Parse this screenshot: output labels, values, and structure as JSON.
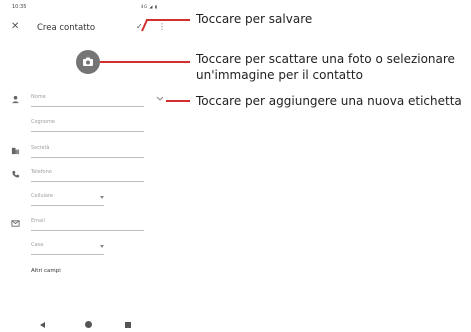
{
  "status": {
    "time": "10:35",
    "icons": "4G ◢ ▮"
  },
  "topbar": {
    "close_glyph": "✕",
    "title": "Crea contatto",
    "check_glyph": "✓",
    "more_glyph": "⋮"
  },
  "form": {
    "name_placeholder": "Nome",
    "surname_placeholder": "Cognome",
    "company_placeholder": "Società",
    "phone_placeholder": "Telefono",
    "phone_type": "Cellulare",
    "email_placeholder": "Email",
    "email_type": "Casa",
    "more_fields": "Altri campi"
  },
  "callouts": {
    "save": "Toccare per salvare",
    "photo": "Toccare per scattare una foto o selezionare un'immagine per il contatto",
    "label": "Toccare per aggiungere una nuova etichetta"
  },
  "colors": {
    "callout_line": "#d32f2f",
    "photo_button": "#757575"
  }
}
